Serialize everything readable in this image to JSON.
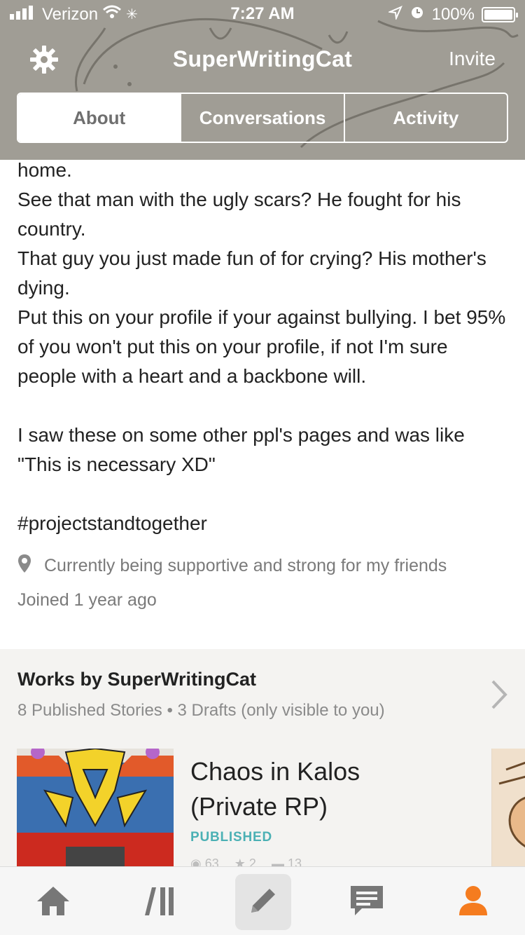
{
  "status_bar": {
    "carrier": "Verizon",
    "time": "7:27 AM",
    "battery": "100%"
  },
  "nav": {
    "title": "SuperWritingCat",
    "invite": "Invite",
    "settings_icon": "gear-icon"
  },
  "tabs": [
    {
      "label": "About",
      "active": true
    },
    {
      "label": "Conversations",
      "active": false
    },
    {
      "label": "Activity",
      "active": false
    }
  ],
  "about": {
    "lines": [
      "home.",
      "See that man with the ugly scars? He fought for his country.",
      "That guy you just made fun of for crying? His mother's dying.",
      "Put this on your profile if your against bullying. I bet 95% of you won't put this on your profile, if not I'm sure people with a heart and a backbone will."
    ],
    "para2": "I saw these on some other ppl's pages and was like \"This is necessary XD\"",
    "hashtag": "#projectstandtogether",
    "location": "Currently being supportive and strong for my friends",
    "joined": "Joined 1 year ago"
  },
  "works": {
    "title": "Works by SuperWritingCat",
    "subtitle": "8 Published Stories • 3 Drafts (only visible to you)",
    "stories": [
      {
        "title": "Chaos in Kalos (Private RP)",
        "status": "PUBLISHED",
        "reads": "63",
        "votes": "2",
        "comments": "13"
      }
    ]
  },
  "bottom_tabs": [
    {
      "icon": "home-icon"
    },
    {
      "icon": "library-icon"
    },
    {
      "icon": "write-icon"
    },
    {
      "icon": "messages-icon"
    },
    {
      "icon": "profile-icon"
    }
  ],
  "colors": {
    "accent_orange": "#f57c1f",
    "published_teal": "#4bb0b4",
    "muted_gray": "#7a7a7a"
  }
}
